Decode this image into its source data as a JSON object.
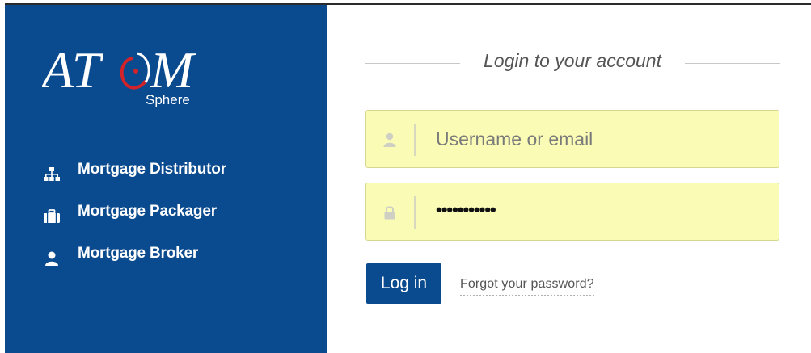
{
  "brand": {
    "logo_text": "ATOM",
    "subtitle": "Sphere"
  },
  "nav": {
    "items": [
      {
        "label": "Mortgage Distributor",
        "icon": "sitemap-icon"
      },
      {
        "label": "Mortgage Packager",
        "icon": "briefcase-icon"
      },
      {
        "label": "Mortgage Broker",
        "icon": "user-icon"
      }
    ]
  },
  "login": {
    "heading": "Login to your account",
    "username": {
      "placeholder": "Username or email",
      "value": "",
      "icon": "user-icon"
    },
    "password": {
      "masked_value": "•••••••••••",
      "icon": "lock-icon"
    },
    "submit_label": "Log in",
    "forgot_label": "Forgot your password?"
  },
  "colors": {
    "brand_blue": "#0a4a8e",
    "input_bg": "#fafcb6",
    "logo_accent": "#d2232a"
  }
}
